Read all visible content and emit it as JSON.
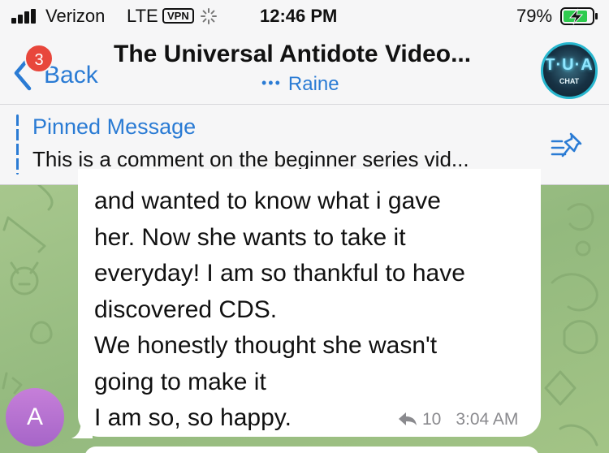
{
  "status_bar": {
    "carrier": "Verizon",
    "network": "LTE",
    "vpn": "VPN",
    "time": "12:46 PM",
    "battery": "79%"
  },
  "nav": {
    "back_label": "Back",
    "unread_badge": "3",
    "title": "The Universal Antidote Video...",
    "subtitle": "Raine",
    "subtitle_dots": "•••",
    "avatar_logo": {
      "main": "T·U·A",
      "sub": "CHAT"
    }
  },
  "pinned": {
    "title": "Pinned Message",
    "text": "This is a comment on the beginner series vid..."
  },
  "message": {
    "lines": [
      "and wanted to know what i gave",
      "her. Now she wants to take it",
      "everyday! I am so thankful to have",
      "discovered CDS.",
      "We honestly thought she wasn't",
      "going to make it",
      "I am so, so happy."
    ],
    "reply_count": "10",
    "time": "3:04 AM",
    "sender_initial": "A"
  },
  "colors": {
    "accent": "#2a7bd4",
    "badge": "#e8473c",
    "chat_bg": "#9dbf86",
    "avatar": "#b873d1"
  }
}
